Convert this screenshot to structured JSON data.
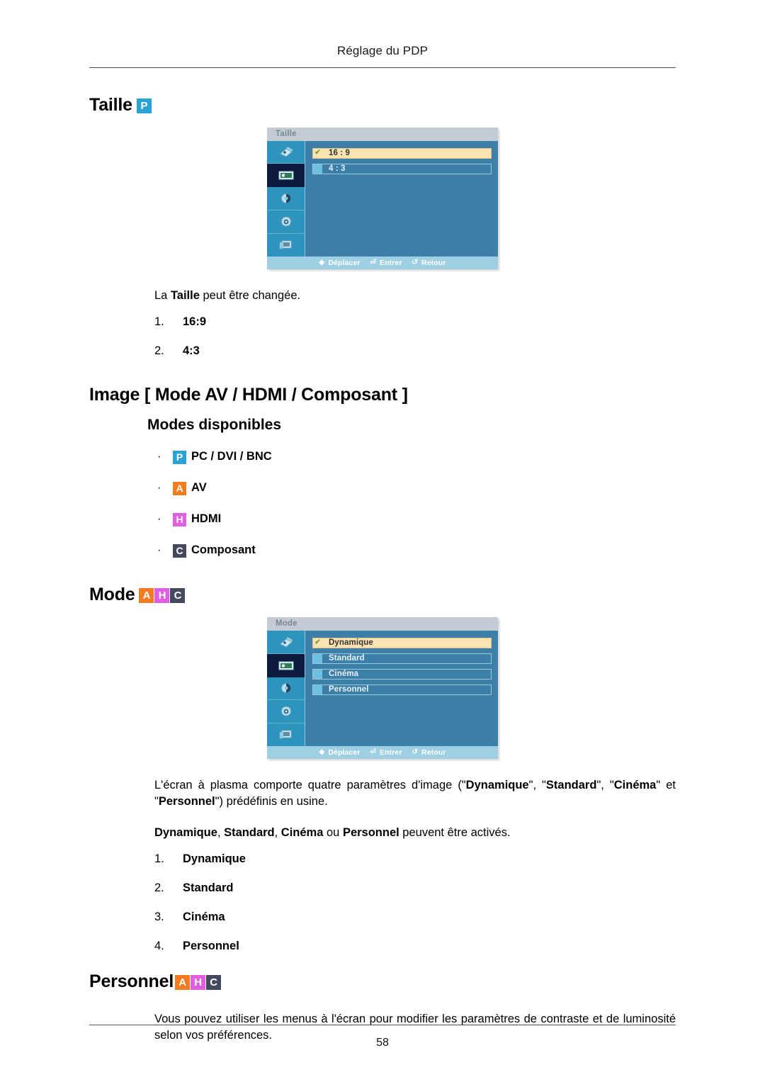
{
  "header": {
    "running_title": "Réglage du PDP"
  },
  "sections": {
    "taille": {
      "heading": "Taille",
      "heading_badges": [
        {
          "letter": "P",
          "kind": "p"
        }
      ],
      "intro_pre": "La ",
      "intro_bold": "Taille",
      "intro_post": " peut être changée.",
      "list": [
        {
          "n": "1.",
          "t": "16:9"
        },
        {
          "n": "2.",
          "t": "4:3"
        }
      ]
    },
    "image": {
      "heading": "Image [ Mode AV / HDMI / Composant ]",
      "sub_heading": "Modes disponibles",
      "bullets": [
        {
          "bullet": "·",
          "badge": "P",
          "kind": "p",
          "label": "PC / DVI / BNC"
        },
        {
          "bullet": "·",
          "badge": "A",
          "kind": "a",
          "label": "AV"
        },
        {
          "bullet": "·",
          "badge": "H",
          "kind": "h",
          "label": "HDMI"
        },
        {
          "bullet": "·",
          "badge": "C",
          "kind": "c",
          "label": "Composant"
        }
      ]
    },
    "mode": {
      "heading": "Mode",
      "heading_badges": [
        {
          "letter": "A",
          "kind": "a"
        },
        {
          "letter": "H",
          "kind": "h"
        },
        {
          "letter": "C",
          "kind": "c"
        }
      ],
      "para1_a": "L'écran à plasma comporte quatre paramètres d'image (\"",
      "para1_b1": "Dynamique",
      "para1_c": "\", \"",
      "para1_b2": "Standard",
      "para1_d": "\", \"",
      "para1_b3": "Cinéma",
      "para1_e": "\" et \"",
      "para1_b4": "Personnel",
      "para1_f": "\") prédéfinis en usine.",
      "para2_b1": "Dynamique",
      "para2_s1": ", ",
      "para2_b2": "Standard",
      "para2_s2": ", ",
      "para2_b3": "Cinéma",
      "para2_s3": " ou ",
      "para2_b4": "Personnel",
      "para2_s4": " peuvent être activés.",
      "list": [
        {
          "n": "1.",
          "t": "Dynamique"
        },
        {
          "n": "2.",
          "t": "Standard"
        },
        {
          "n": "3.",
          "t": "Cinéma"
        },
        {
          "n": "4.",
          "t": "Personnel"
        }
      ]
    },
    "personnel": {
      "heading": "Personnel",
      "heading_badges": [
        {
          "letter": "A",
          "kind": "a"
        },
        {
          "letter": "H",
          "kind": "h"
        },
        {
          "letter": "C",
          "kind": "c"
        }
      ],
      "para": "Vous pouvez utiliser les menus à l'écran pour modifier les paramètres de contraste et de luminosité selon vos préférences."
    }
  },
  "osd_taille": {
    "title": "Taille",
    "sidebar_icons": [
      "input-source-icon",
      "picture-icon",
      "sound-icon",
      "setup-icon",
      "multi-control-icon"
    ],
    "selected_sidebar_index": 1,
    "rows": [
      {
        "label": "16 : 9",
        "selected": true,
        "check": "✔"
      },
      {
        "label": "4 : 3",
        "selected": false,
        "check": ""
      }
    ],
    "footer": [
      {
        "glyph": "◆",
        "icon": "move-icon",
        "label": "Déplacer"
      },
      {
        "glyph": "⏎",
        "icon": "enter-icon",
        "label": "Entrer"
      },
      {
        "glyph": "↺",
        "icon": "return-icon",
        "label": "Retour"
      }
    ]
  },
  "osd_mode": {
    "title": "Mode",
    "sidebar_icons": [
      "input-source-icon",
      "picture-icon",
      "sound-icon",
      "setup-icon",
      "multi-control-icon"
    ],
    "selected_sidebar_index": 1,
    "rows": [
      {
        "label": "Dynamique",
        "selected": true,
        "check": "✔"
      },
      {
        "label": "Standard",
        "selected": false,
        "check": ""
      },
      {
        "label": "Cinéma",
        "selected": false,
        "check": ""
      },
      {
        "label": "Personnel",
        "selected": false,
        "check": ""
      }
    ],
    "footer": [
      {
        "glyph": "◆",
        "icon": "move-icon",
        "label": "Déplacer"
      },
      {
        "glyph": "⏎",
        "icon": "enter-icon",
        "label": "Entrer"
      },
      {
        "glyph": "↺",
        "icon": "return-icon",
        "label": "Retour"
      }
    ]
  },
  "footer": {
    "page_number": "58"
  },
  "colors": {
    "badge_p": "#29a3d4",
    "badge_a": "#f47b20",
    "badge_h": "#e05fe0",
    "badge_c": "#45495e",
    "osd_panel": "#3c7fa8",
    "osd_sidebar": "#2d94bd",
    "osd_selected_row": "#fce3b2",
    "osd_titlebar": "#c3ccd4",
    "osd_footer": "#9ecfe2"
  }
}
